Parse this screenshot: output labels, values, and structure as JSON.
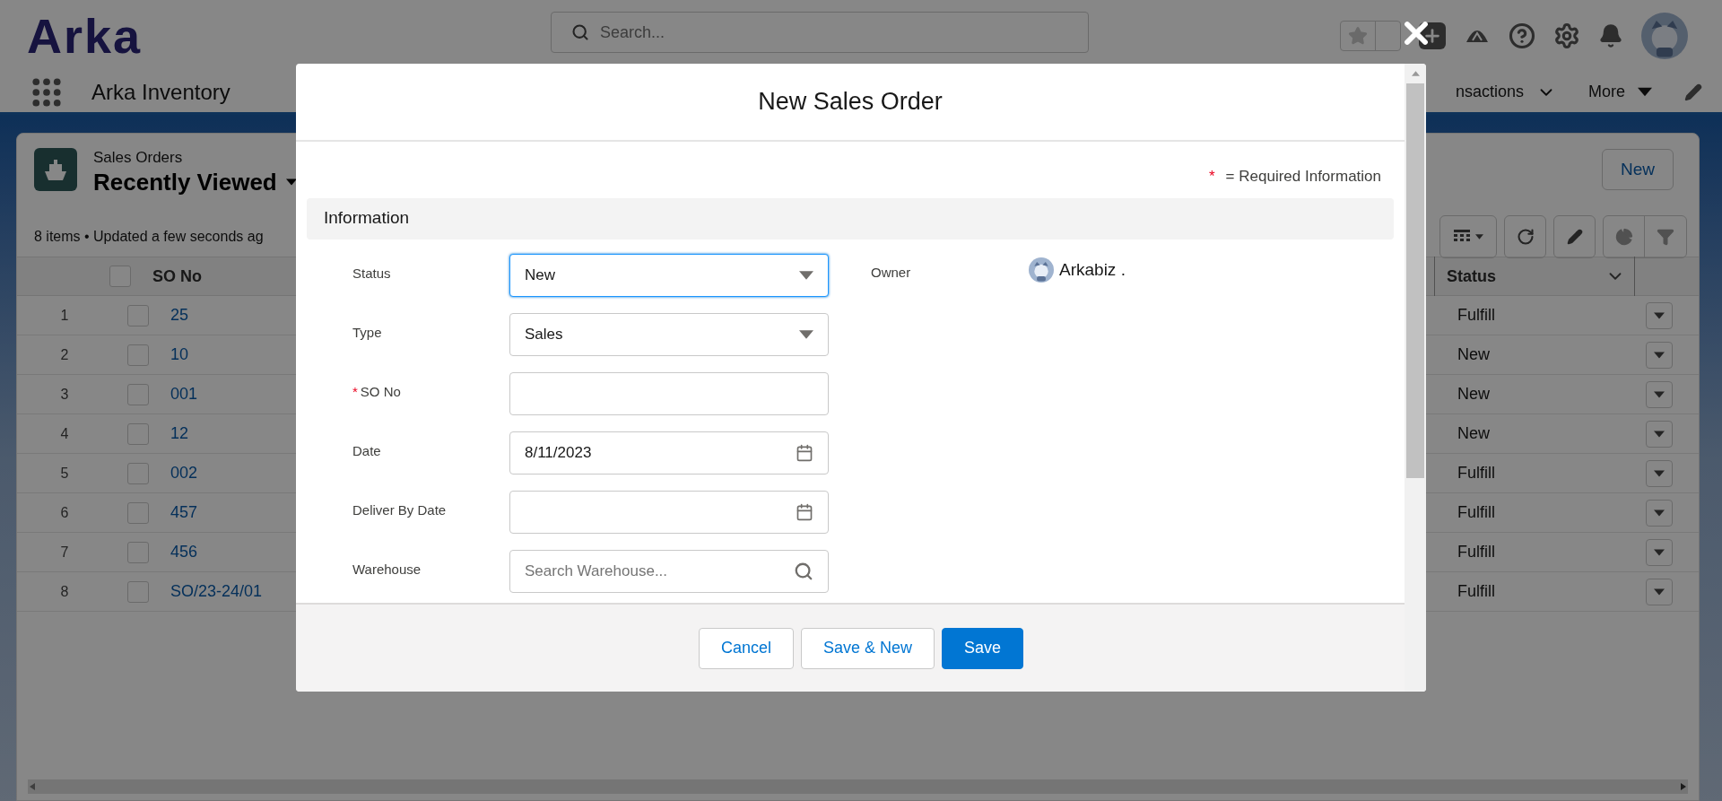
{
  "app_header": {
    "logo": "Arka",
    "search": {
      "placeholder": "Search..."
    }
  },
  "nav": {
    "app_name": "Arka Inventory",
    "items": [
      {
        "label": "nsactions",
        "kind": "chevron"
      },
      {
        "label": "More",
        "kind": "caret"
      }
    ]
  },
  "list_view": {
    "object": "Sales Orders",
    "view": "Recently Viewed",
    "summary": "8 items • Updated a few seconds ag",
    "new_button": "New",
    "header_checked": false,
    "columns": [
      "SO No",
      "Status"
    ],
    "rows": [
      {
        "number": "1",
        "so_no": "25",
        "status": "Fulfill",
        "checked": false
      },
      {
        "number": "2",
        "so_no": "10",
        "status": "New",
        "checked": false
      },
      {
        "number": "3",
        "so_no": "001",
        "status": "New",
        "checked": false
      },
      {
        "number": "4",
        "so_no": "12",
        "status": "New",
        "checked": false
      },
      {
        "number": "5",
        "so_no": "002",
        "status": "Fulfill",
        "checked": false
      },
      {
        "number": "6",
        "so_no": "457",
        "status": "Fulfill",
        "checked": false
      },
      {
        "number": "7",
        "so_no": "456",
        "status": "Fulfill",
        "checked": false
      },
      {
        "number": "8",
        "so_no": "SO/23-24/01",
        "status": "Fulfill",
        "checked": false
      }
    ]
  },
  "modal": {
    "title": "New Sales Order",
    "required_mark": "*",
    "required_note": "= Required Information",
    "section": "Information",
    "owner": {
      "label": "Owner",
      "value": "Arkabiz ."
    },
    "fields": [
      {
        "label": "Status",
        "kind": "select",
        "value": "New",
        "required": false,
        "focused": true
      },
      {
        "label": "Type",
        "kind": "select",
        "value": "Sales",
        "required": false,
        "focused": false
      },
      {
        "label": "SO No",
        "kind": "text",
        "required": true,
        "focused": false
      },
      {
        "label": "Date",
        "kind": "date",
        "value": "8/11/2023",
        "required": false,
        "focused": false
      },
      {
        "label": "Deliver By Date",
        "kind": "date",
        "required": false,
        "focused": false
      },
      {
        "label": "Warehouse",
        "kind": "lookup",
        "placeholder": "Search Warehouse...",
        "required": false,
        "focused": false
      }
    ],
    "buttons": [
      {
        "label": "Cancel",
        "kind": "neutral"
      },
      {
        "label": "Save & New",
        "kind": "neutral"
      },
      {
        "label": "Save",
        "kind": "brand"
      }
    ]
  }
}
